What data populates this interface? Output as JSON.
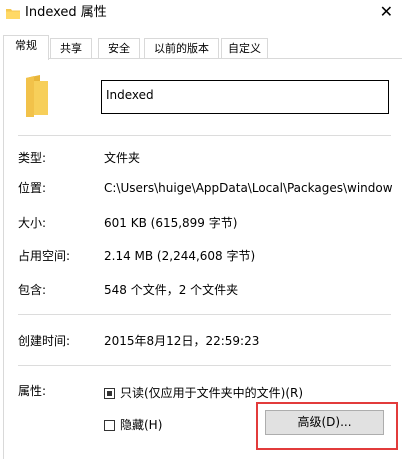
{
  "window": {
    "title": "Indexed 属性",
    "close_glyph": "✕"
  },
  "tabs": [
    {
      "label": "常规",
      "active": true
    },
    {
      "label": "共享",
      "active": false
    },
    {
      "label": "安全",
      "active": false
    },
    {
      "label": "以前的版本",
      "active": false
    },
    {
      "label": "自定义",
      "active": false
    }
  ],
  "general": {
    "folder_name": "Indexed",
    "type": {
      "label": "类型:",
      "value": "文件夹"
    },
    "location": {
      "label": "位置:",
      "value": "C:\\Users\\huige\\AppData\\Local\\Packages\\window"
    },
    "size": {
      "label": "大小:",
      "value": "601 KB (615,899 字节)"
    },
    "size_on_disk": {
      "label": "占用空间:",
      "value": "2.14 MB (2,244,608 字节)"
    },
    "contains": {
      "label": "包含:",
      "value": "548 个文件，2 个文件夹"
    },
    "created": {
      "label": "创建时间:",
      "value": "2015年8月12日，22:59:23"
    },
    "attributes": {
      "label": "属性:",
      "readonly_label": "只读(仅应用于文件夹中的文件)(R)",
      "readonly_state": "indeterminate",
      "hidden_label": "隐藏(H)",
      "hidden_state": "unchecked",
      "advanced_button": "高级(D)..."
    }
  },
  "colors": {
    "folder": "#f5c850",
    "highlight_frame": "#e23b3b"
  }
}
